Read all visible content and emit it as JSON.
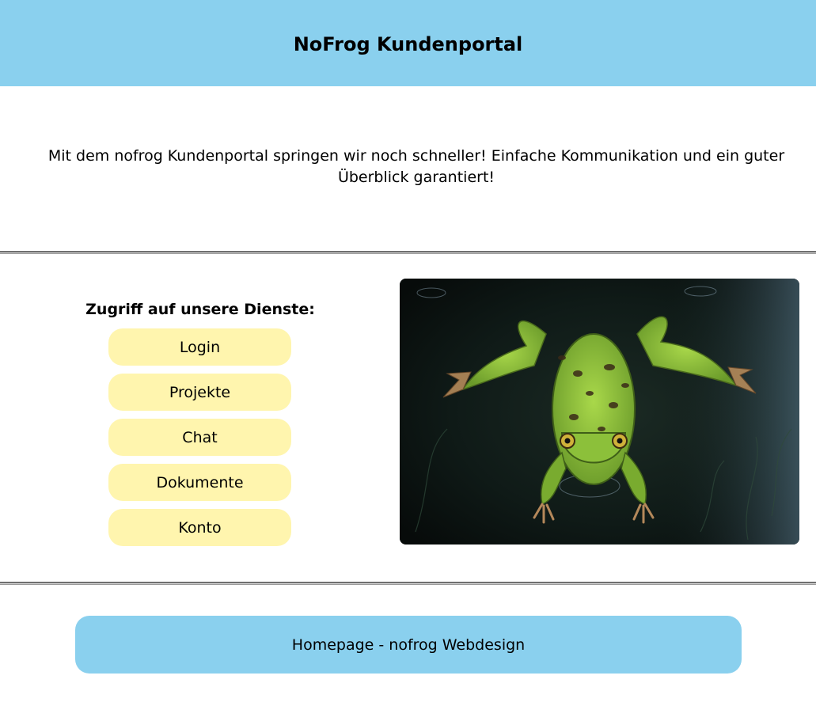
{
  "header": {
    "title": "NoFrog Kundenportal"
  },
  "intro": {
    "text": "Mit dem nofrog Kundenportal springen wir noch schneller! Einfache Kommunikation und ein guter Überblick garantiert!"
  },
  "services": {
    "title": "Zugriff auf unsere Dienste:",
    "buttons": [
      {
        "label": "Login"
      },
      {
        "label": "Projekte"
      },
      {
        "label": "Chat"
      },
      {
        "label": "Dokumente"
      },
      {
        "label": "Konto"
      }
    ]
  },
  "footer": {
    "link_label": "Homepage - nofrog Webdesign"
  },
  "colors": {
    "header_bg": "#8ad0ee",
    "button_bg": "#fff5ae",
    "footer_bg": "#8ad0ee"
  }
}
